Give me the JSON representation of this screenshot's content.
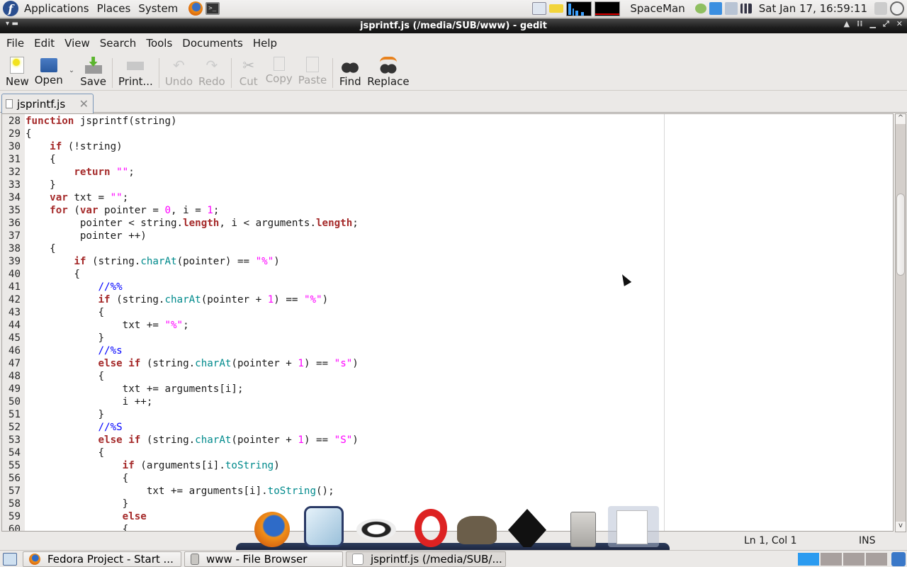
{
  "top_panel": {
    "menus": [
      "Applications",
      "Places",
      "System"
    ],
    "launchers": [
      "firefox-icon",
      "terminal-icon"
    ],
    "user": "SpaceMan",
    "clock": "Sat Jan 17, 16:59:11"
  },
  "window": {
    "title": "jsprintf.js (/media/SUB/www) - gedit"
  },
  "menubar": [
    "File",
    "Edit",
    "View",
    "Search",
    "Tools",
    "Documents",
    "Help"
  ],
  "toolbar": {
    "new": "New",
    "open": "Open",
    "save": "Save",
    "print": "Print...",
    "undo": "Undo",
    "redo": "Redo",
    "cut": "Cut",
    "copy": "Copy",
    "paste": "Paste",
    "find": "Find",
    "replace": "Replace"
  },
  "tabs": [
    {
      "label": "jsprintf.js",
      "active": true
    }
  ],
  "editor": {
    "lines": [
      {
        "n": "28",
        "html": "<span class='k'>function</span> jsprintf(string)"
      },
      {
        "n": "29",
        "html": "{"
      },
      {
        "n": "30",
        "html": "    <span class='k'>if</span> (!string)"
      },
      {
        "n": "31",
        "html": "    {"
      },
      {
        "n": "32",
        "html": "        <span class='k'>return</span> <span class='s'>\"\"</span>;"
      },
      {
        "n": "33",
        "html": "    }"
      },
      {
        "n": "34",
        "html": "    <span class='k'>var</span> txt = <span class='s'>\"\"</span>;"
      },
      {
        "n": "35",
        "html": "    <span class='k'>for</span> (<span class='k'>var</span> pointer = <span class='n'>0</span>, i = <span class='n'>1</span>;"
      },
      {
        "n": "36",
        "html": "         pointer &lt; string.<span class='k'>length</span>, i &lt; arguments.<span class='k'>length</span>;"
      },
      {
        "n": "37",
        "html": "         pointer ++)"
      },
      {
        "n": "38",
        "html": "    {"
      },
      {
        "n": "39",
        "html": "        <span class='k'>if</span> (string.<span class='f'>charAt</span>(pointer) == <span class='s'>\"%\"</span>)"
      },
      {
        "n": "40",
        "html": "        {"
      },
      {
        "n": "41",
        "html": "            <span class='c'>//%%</span>"
      },
      {
        "n": "42",
        "html": "            <span class='k'>if</span> (string.<span class='f'>charAt</span>(pointer + <span class='n'>1</span>) == <span class='s'>\"%\"</span>)"
      },
      {
        "n": "43",
        "html": "            {"
      },
      {
        "n": "44",
        "html": "                txt += <span class='s'>\"%\"</span>;"
      },
      {
        "n": "45",
        "html": "            }"
      },
      {
        "n": "46",
        "html": "            <span class='c'>//%s</span>"
      },
      {
        "n": "47",
        "html": "            <span class='k'>else if</span> (string.<span class='f'>charAt</span>(pointer + <span class='n'>1</span>) == <span class='s'>\"s\"</span>)"
      },
      {
        "n": "48",
        "html": "            {"
      },
      {
        "n": "49",
        "html": "                txt += arguments[i];"
      },
      {
        "n": "50",
        "html": "                i ++;"
      },
      {
        "n": "51",
        "html": "            }"
      },
      {
        "n": "52",
        "html": "            <span class='c'>//%S</span>"
      },
      {
        "n": "53",
        "html": "            <span class='k'>else if</span> (string.<span class='f'>charAt</span>(pointer + <span class='n'>1</span>) == <span class='s'>\"S\"</span>)"
      },
      {
        "n": "54",
        "html": "            {"
      },
      {
        "n": "55",
        "html": "                <span class='k'>if</span> (arguments[i].<span class='f'>toString</span>)"
      },
      {
        "n": "56",
        "html": "                {"
      },
      {
        "n": "57",
        "html": "                    txt += arguments[i].<span class='f'>toString</span>();"
      },
      {
        "n": "58",
        "html": "                }"
      },
      {
        "n": "59",
        "html": "                <span class='k'>else</span>"
      },
      {
        "n": "60",
        "html": "                {"
      }
    ]
  },
  "statusbar": {
    "position": "Ln 1, Col 1",
    "mode": "INS"
  },
  "dock": [
    "firefox-icon",
    "netbeans-icon",
    "pidgin-icon",
    "opera-icon",
    "gimp-icon",
    "inkscape-icon",
    "file-cabinet-icon",
    "gedit-icon"
  ],
  "taskbar": [
    {
      "label": "Fedora Project - Start ...",
      "icon": "firefox-icon"
    },
    {
      "label": "www - File Browser",
      "icon": "file-cabinet-icon"
    },
    {
      "label": "jsprintf.js (/media/SUB/...",
      "icon": "gedit-icon",
      "active": true
    }
  ],
  "workspaces": {
    "count": 4,
    "active": 1
  }
}
